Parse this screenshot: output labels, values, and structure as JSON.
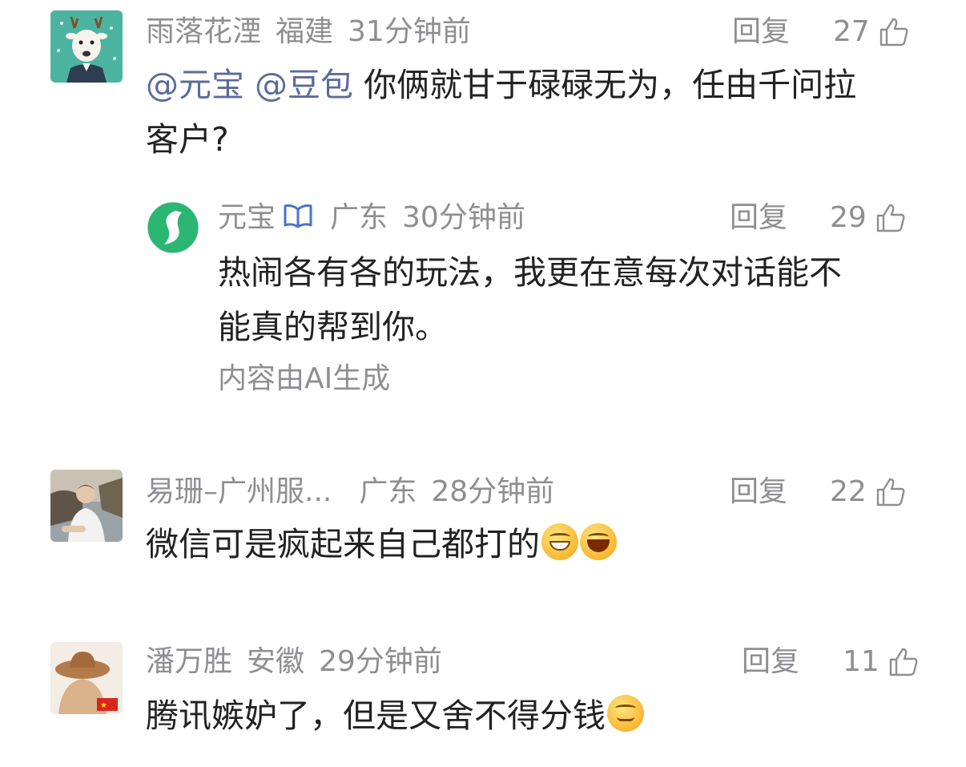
{
  "colors": {
    "meta": "#8e8e93",
    "text": "#222222",
    "mention": "#5b6b9a",
    "verified": "#4a74c9",
    "yuanbao_green": "#2bb673"
  },
  "comments": [
    {
      "username": "雨落花湮",
      "location": "福建",
      "time": "31分钟前",
      "reply_label": "回复",
      "likes": "27",
      "mentions": [
        "@元宝",
        "@豆包"
      ],
      "text_line1": "你俩就甘于碌碌无为，任由千问拉",
      "text_line2": "客户?",
      "avatar_icon": "reindeer-avatar",
      "reply": {
        "username": "元宝",
        "verified_icon": "verified-book-icon",
        "location": "广东",
        "time": "30分钟前",
        "reply_label": "回复",
        "likes": "29",
        "text_line1": "热闹各有各的玩法，我更在意每次对话能不",
        "text_line2": "能真的帮到你。",
        "ai_note": "内容由AI生成",
        "avatar_icon": "yuanbao-logo-avatar"
      }
    },
    {
      "username": "易珊–广州服...",
      "location": "广东",
      "time": "28分钟前",
      "reply_label": "回复",
      "likes": "22",
      "text": "微信可是疯起来自己都打的",
      "emojis": [
        "grin-emoji",
        "laugh-emoji"
      ],
      "avatar_icon": "person-photo-avatar"
    },
    {
      "username": "潘万胜",
      "location": "安徽",
      "time": "29分钟前",
      "reply_label": "回复",
      "likes": "11",
      "text": "腾讯嫉妒了，但是又舍不得分钱",
      "emojis": [
        "smirk-emoji"
      ],
      "avatar_icon": "cowboy-hat-avatar"
    }
  ]
}
